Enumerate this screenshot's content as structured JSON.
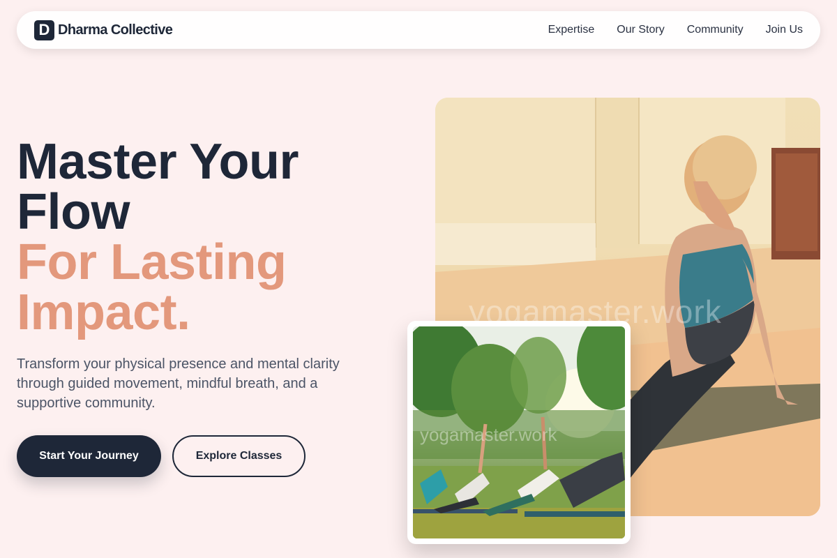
{
  "nav": {
    "logo_letter": "D",
    "brand": "Dharma Collective",
    "links": [
      "Expertise",
      "Our Story",
      "Community",
      "Join Us"
    ]
  },
  "hero": {
    "line1": "Master Your",
    "line2": "Flow",
    "line3": "For Lasting",
    "line4": "Impact.",
    "subtitle": "Transform your physical presence and mental clarity through guided movement, mindful breath, and a supportive community.",
    "primary_cta": "Start Your Journey",
    "secondary_cta": "Explore Classes"
  },
  "images": {
    "main_watermark": "yogamaster.work",
    "inset_watermark": "yogamaster.work"
  },
  "colors": {
    "background": "#fdf0f0",
    "dark": "#1e2738",
    "accent": "#e3987c"
  }
}
